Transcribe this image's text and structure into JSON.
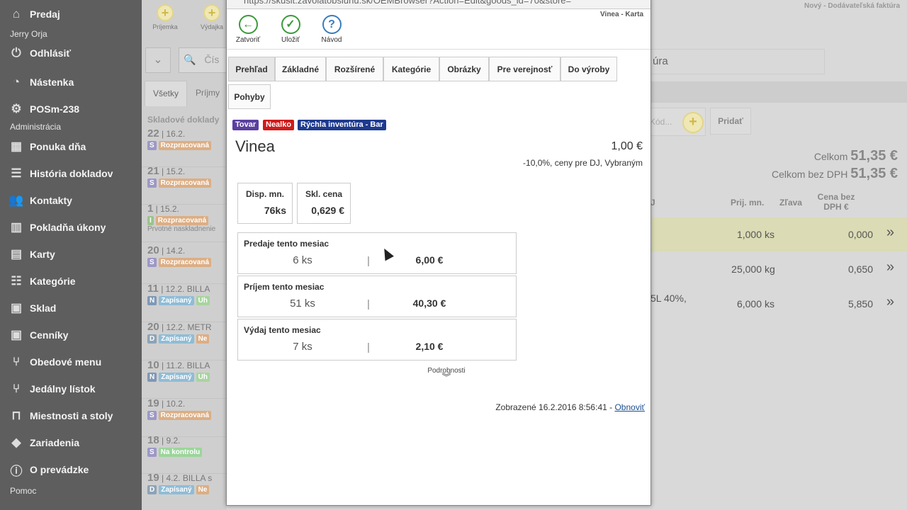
{
  "sidebar": {
    "predaj": "Predaj",
    "user": "Jerry Orja",
    "logout": "Odhlásiť",
    "dashboard": "Nástenka",
    "pos": "POSm-238",
    "section_admin": "Administrácia",
    "items": [
      {
        "label": "Ponuka dňa",
        "icon": "offer-icon"
      },
      {
        "label": "História dokladov",
        "icon": "list-icon"
      },
      {
        "label": "Kontakty",
        "icon": "contacts-icon"
      },
      {
        "label": "Pokladňa úkony",
        "icon": "chart-icon"
      },
      {
        "label": "Karty",
        "icon": "cards-icon"
      },
      {
        "label": "Kategórie",
        "icon": "categories-icon"
      },
      {
        "label": "Sklad",
        "icon": "warehouse-icon"
      },
      {
        "label": "Cenníky",
        "icon": "pricelist-icon"
      },
      {
        "label": "Obedové menu",
        "icon": "cutlery-icon"
      },
      {
        "label": "Jedálny lístok",
        "icon": "cutlery-icon"
      },
      {
        "label": "Miestnosti a stoly",
        "icon": "table-icon"
      },
      {
        "label": "Zariadenia",
        "icon": "device-icon"
      },
      {
        "label": "O prevádzke",
        "icon": "info-icon"
      }
    ],
    "section_help": "Pomoc"
  },
  "doclist": {
    "btn_prijemka": "Príjemka",
    "btn_vydajka": "Výdajka",
    "search_placeholder": "Čís",
    "tab_all": "Všetky",
    "tab_prijmy": "Príjmy",
    "section_title": "Skladové doklady",
    "rows": [
      {
        "num": "22",
        "date": "16.2.",
        "extra": "",
        "type": "S",
        "status": "Rozpracovaná",
        "more": "",
        "note": ""
      },
      {
        "num": "21",
        "date": "15.2.",
        "extra": "",
        "type": "S",
        "status": "Rozpracovaná",
        "more": "",
        "note": ""
      },
      {
        "num": "1",
        "date": "15.2.",
        "extra": "",
        "type": "I",
        "status": "Rozpracovaná",
        "more": "",
        "note": "Prvotné naskladnenie"
      },
      {
        "num": "20",
        "date": "14.2.",
        "extra": "",
        "type": "S",
        "status": "Rozpracovaná",
        "more": "",
        "note": ""
      },
      {
        "num": "11",
        "date": "12.2.",
        "extra": "BILLA",
        "type": "N",
        "status": "Zapísaný",
        "more": "Uh",
        "note": ""
      },
      {
        "num": "20",
        "date": "12.2.",
        "extra": "METR",
        "type": "D",
        "status": "Zapísaný",
        "more": "Ne",
        "note": ""
      },
      {
        "num": "10",
        "date": "11.2.",
        "extra": "BILLA",
        "type": "N",
        "status": "Zapísaný",
        "more": "Uh",
        "note": ""
      },
      {
        "num": "19",
        "date": "10.2.",
        "extra": "",
        "type": "S",
        "status": "Rozpracovaná",
        "more": "",
        "note": ""
      },
      {
        "num": "18",
        "date": "9.2.",
        "extra": "",
        "type": "S",
        "status": "Na kontrolu",
        "more": "",
        "note": ""
      },
      {
        "num": "19",
        "date": "4.2.",
        "extra": "BILLA s",
        "type": "D",
        "status": "Zapísaný",
        "more": "Ne",
        "note": ""
      }
    ]
  },
  "rightpanel": {
    "title": "Nový - Dodávateľská faktúra",
    "doc_label": "úra",
    "code_placeholder": "Kód...",
    "add_button": "Pridať",
    "total_label": "Celkom",
    "total_value": "51,35 €",
    "total_novat_label": "Celkom bez DPH",
    "total_novat_value": "51,35 €",
    "col_j": "J",
    "col_qty": "Prij. mn.",
    "col_discount": "Zľava",
    "col_price": "Cena bez DPH €",
    "rows": [
      {
        "desc": "",
        "qty": "1,000",
        "unit": "ks",
        "price": "0,000"
      },
      {
        "desc": "",
        "qty": "25,000",
        "unit": "kg",
        "price": "0,650"
      },
      {
        "desc": "5L 40%,",
        "qty": "6,000",
        "unit": "ks",
        "price": "5,850"
      }
    ]
  },
  "modal": {
    "url": "https://skusit.zavolatobsluhu.sk/OEMBrowser?Action=Edit&goods_id=70&store=",
    "window_title": "Vinea - Karta",
    "toolbar": {
      "close": "Zatvoriť",
      "save": "Uložiť",
      "help": "Návod"
    },
    "tabs": [
      "Prehľad",
      "Základné",
      "Rozšírené",
      "Kategórie",
      "Obrázky",
      "Pre verejnosť",
      "Do výroby",
      "Pohyby"
    ],
    "badges": [
      {
        "label": "Tovar",
        "color": "#5b3fa0"
      },
      {
        "label": "Nealko",
        "color": "#d01a1a"
      },
      {
        "label": "Rýchla inventúra - Bar",
        "color": "#1e3a8f"
      }
    ],
    "name": "Vinea",
    "price": "1,00 €",
    "price_note": "-10,0%, ceny pre DJ, Vybraným",
    "disp_label": "Disp. mn.",
    "disp_value": "76ks",
    "skl_label": "Skl. cena",
    "skl_value": "0,629 €",
    "stats": [
      {
        "title": "Predaje tento mesiac",
        "qty": "6 ks",
        "amount": "6,00 €"
      },
      {
        "title": "Príjem tento mesiac",
        "qty": "51 ks",
        "amount": "40,30 €"
      },
      {
        "title": "Výdaj tento mesiac",
        "qty": "7 ks",
        "amount": "2,10 €"
      }
    ],
    "details": "Podrobnosti",
    "shown_prefix": "Zobrazené 16.2.2016 8:56:41 -",
    "refresh": "Obnoviť"
  }
}
